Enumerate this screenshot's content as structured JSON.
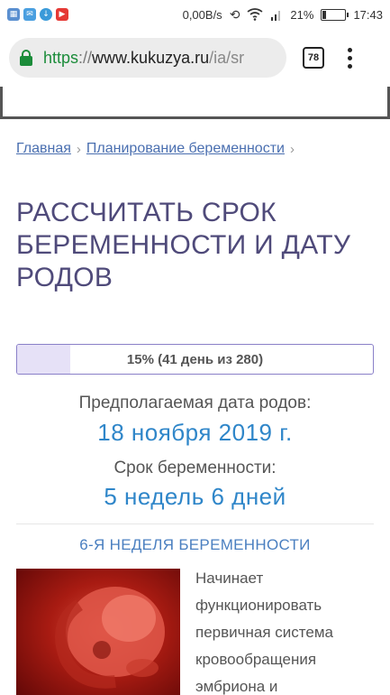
{
  "status_bar": {
    "notification_icons": [
      "gallery-icon",
      "message-icon",
      "download-icon",
      "youtube-icon"
    ],
    "network_speed": "0,00B/s",
    "battery_percent": "21%",
    "battery_level": 0.21,
    "time": "17:43"
  },
  "browser": {
    "url": {
      "scheme": "https",
      "separator": "://",
      "host": "www.kukuzya.ru",
      "path": "/ia/sr"
    },
    "tab_count": "78"
  },
  "breadcrumb": {
    "items": [
      "Главная",
      "Планирование беременности"
    ]
  },
  "page": {
    "title": "РАССЧИТАТЬ СРОК БЕРЕМЕННОСТИ И ДАТУ РОДОВ"
  },
  "progress": {
    "label": "15% (41 день из 280)",
    "fraction": 0.15
  },
  "due_date": {
    "label": "Предполагаемая дата родов:",
    "value": "18 ноября 2019 г."
  },
  "pregnancy_term": {
    "label": "Срок беременности:",
    "value": "5 недель 6 дней"
  },
  "article": {
    "heading": "6-Я НЕДЕЛЯ БЕРЕМЕННОСТИ",
    "text_lines": [
      "Начинает",
      "функционировать",
      "первичная система",
      "кровообращения",
      "эмбриона и"
    ]
  },
  "colors": {
    "accent": "#2f86c9",
    "title": "#4f4a7a",
    "link": "#4a6fb0",
    "progress_border": "#8a80c8",
    "progress_fill": "#e6e1f7",
    "secure": "#1b8c3a"
  }
}
